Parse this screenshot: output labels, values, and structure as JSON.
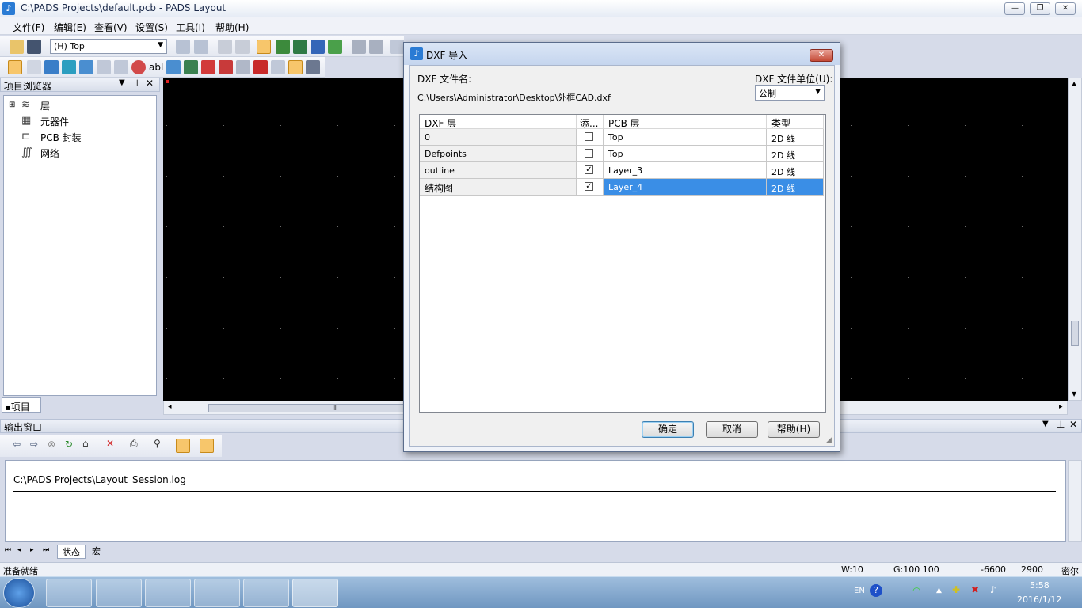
{
  "window": {
    "title": "C:\\PADS Projects\\default.pcb - PADS Layout"
  },
  "menu": [
    "文件(F)",
    "编辑(E)",
    "查看(V)",
    "设置(S)",
    "工具(I)",
    "帮助(H)"
  ],
  "toolbar": {
    "layer_combo": "(H) Top"
  },
  "project_browser": {
    "title": "项目浏览器",
    "tree": [
      "层",
      "元器件",
      "PCB 封装",
      "网络"
    ],
    "tab": "项目"
  },
  "dialog": {
    "title": "DXF 导入",
    "file_label": "DXF 文件名:",
    "file_path": "C:\\Users\\Administrator\\Desktop\\外框CAD.dxf",
    "unit_label": "DXF 文件单位(U):",
    "unit_value": "公制",
    "columns": [
      "DXF 层",
      "添...",
      "PCB 层",
      "类型"
    ],
    "rows": [
      {
        "dxf": "0",
        "checked": false,
        "pcb": "Top",
        "type": "2D 线"
      },
      {
        "dxf": "Defpoints",
        "checked": false,
        "pcb": "Top",
        "type": "2D 线"
      },
      {
        "dxf": "outline",
        "checked": true,
        "pcb": "Layer_3",
        "type": "2D 线"
      },
      {
        "dxf": "结构图",
        "checked": true,
        "pcb": "Layer_4",
        "type": "2D 线"
      }
    ],
    "ok": "确定",
    "cancel": "取消",
    "help": "帮助(H)"
  },
  "output": {
    "title": "输出窗口",
    "log": "C:\\PADS Projects\\Layout_Session.log",
    "tabs": [
      "状态",
      "宏"
    ]
  },
  "status": {
    "ready": "准备就绪",
    "w": "W:10",
    "g": "G:100 100",
    "x": "-6600",
    "y": "2900",
    "unit": "密尔"
  },
  "tray": {
    "lang": "EN",
    "time": "5:58",
    "date": "2016/1/12"
  },
  "scroll_label": "III"
}
